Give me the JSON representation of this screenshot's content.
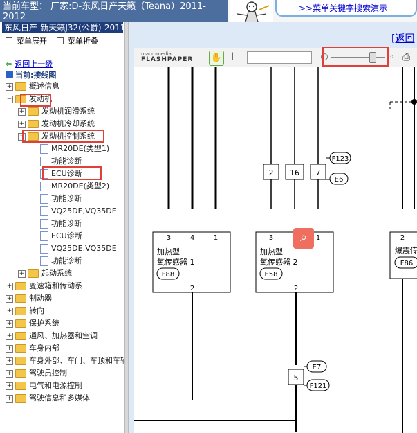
{
  "header": {
    "model_line1": "当前车型：  厂家:D-东风日产天籁（Teana）2011-",
    "model_line2": "2012",
    "demo_link": ">>菜单关键字搜索演示"
  },
  "sidebar": {
    "car_title": "东风日产-新天籁J32(公爵)-2011",
    "expand_label": "菜单展开",
    "collapse_label": "菜单折叠",
    "back_up": "返回上一级",
    "current": "当前:接线图",
    "tree": [
      {
        "label": "概述信息",
        "type": "folder",
        "toggle": "+",
        "level": 0
      },
      {
        "label": "发动机",
        "type": "folder",
        "toggle": "−",
        "level": 0
      },
      {
        "label": "发动机润滑系统",
        "type": "folder",
        "toggle": "+",
        "level": 1
      },
      {
        "label": "发动机冷却系统",
        "type": "folder",
        "toggle": "+",
        "level": 1
      },
      {
        "label": "发动机控制系统",
        "type": "folder",
        "toggle": "−",
        "level": 1
      },
      {
        "label": "MR20DE(类型1)",
        "type": "doc",
        "level": 2
      },
      {
        "label": "功能诊断",
        "type": "doc",
        "level": 2
      },
      {
        "label": "ECU诊断",
        "type": "doc",
        "level": 2
      },
      {
        "label": "MR20DE(类型2)",
        "type": "doc",
        "level": 2
      },
      {
        "label": "功能诊断",
        "type": "doc",
        "level": 2
      },
      {
        "label": "VQ25DE,VQ35DE",
        "type": "doc",
        "level": 2
      },
      {
        "label": "功能诊断",
        "type": "doc",
        "level": 2
      },
      {
        "label": "ECU诊断",
        "type": "doc",
        "level": 2
      },
      {
        "label": "VQ25DE,VQ35DE",
        "type": "doc",
        "level": 2
      },
      {
        "label": "功能诊断",
        "type": "doc",
        "level": 2
      },
      {
        "label": "起动系统",
        "type": "folder",
        "toggle": "+",
        "level": 1
      },
      {
        "label": "变速箱和传动系",
        "type": "folder",
        "toggle": "+",
        "level": 0
      },
      {
        "label": "制动器",
        "type": "folder",
        "toggle": "+",
        "level": 0
      },
      {
        "label": "转向",
        "type": "folder",
        "toggle": "+",
        "level": 0
      },
      {
        "label": "保护系统",
        "type": "folder",
        "toggle": "+",
        "level": 0
      },
      {
        "label": "通风、加热器和空调",
        "type": "folder",
        "toggle": "+",
        "level": 0
      },
      {
        "label": "车身内部",
        "type": "folder",
        "toggle": "+",
        "level": 0
      },
      {
        "label": "车身外部、车门、车顶和车辆",
        "type": "folder",
        "toggle": "+",
        "level": 0
      },
      {
        "label": "驾驶员控制",
        "type": "folder",
        "toggle": "+",
        "level": 0
      },
      {
        "label": "电气和电源控制",
        "type": "folder",
        "toggle": "+",
        "level": 0
      },
      {
        "label": "驾驶信息和多媒体",
        "type": "folder",
        "toggle": "+",
        "level": 0
      }
    ]
  },
  "main": {
    "back_link": "[返回",
    "flashpaper_brand_small": "macromedia",
    "flashpaper_brand": "FLASHPAPER",
    "zoom_level": 0.75
  },
  "diagram": {
    "connectors": [
      "2",
      "16",
      "7",
      "5"
    ],
    "labels_top": [
      "F123",
      "E6"
    ],
    "labels_bottom": [
      "E7",
      "F121"
    ],
    "sensor1": {
      "pins": [
        "3",
        "4",
        "1"
      ],
      "name_line1": "加热型",
      "name_line2": "氧传感器 1",
      "code": "F88",
      "bottom_pin": "2"
    },
    "sensor2": {
      "pins": [
        "3",
        "4",
        "1"
      ],
      "name_line1": "加热型",
      "name_line2": "氧传感器 2",
      "code": "E58",
      "bottom_pin": "2"
    },
    "knock": {
      "pin": "2",
      "name": "爆震传",
      "code": "F86"
    }
  },
  "colors": {
    "header_bg": "#4c6e9e",
    "title_bg": "#1f3d7a",
    "highlight": "#e0403a",
    "link": "#0000cc"
  }
}
